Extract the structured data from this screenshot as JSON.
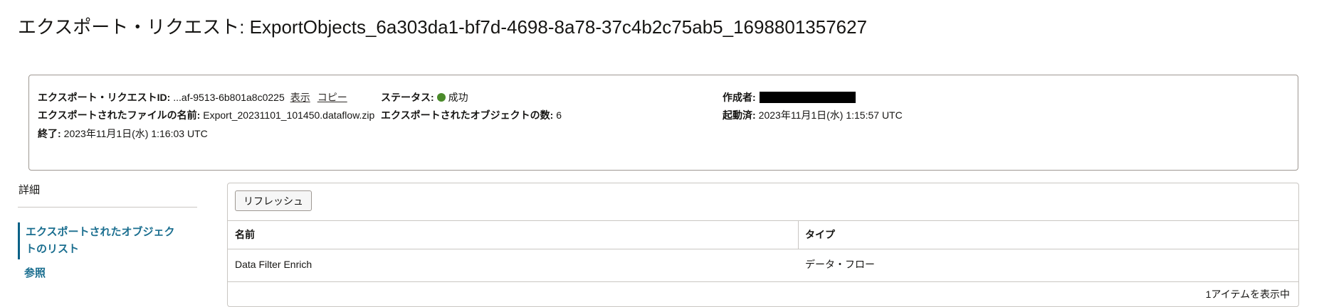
{
  "page": {
    "title": "エクスポート・リクエスト: ExportObjects_6a303da1-bf7d-4698-8a78-37c4b2c75ab5_1698801357627"
  },
  "details": {
    "request_id": {
      "label": "エクスポート・リクエストID",
      "value": "...af-9513-6b801a8c0225",
      "show_link": "表示",
      "copy_link": "コピー"
    },
    "status": {
      "label": "ステータス",
      "value": "成功",
      "color": "#4a8a2a"
    },
    "created_by": {
      "label": "作成者"
    },
    "exported_file": {
      "label": "エクスポートされたファイルの名前",
      "value": "Export_20231101_101450.dataflow.zip"
    },
    "object_count": {
      "label": "エクスポートされたオブジェクトの数",
      "value": "6"
    },
    "started": {
      "label": "起動済",
      "value": "2023年11月1日(水) 1:15:57 UTC"
    },
    "finished": {
      "label": "終了",
      "value": "2023年11月1日(水) 1:16:03 UTC"
    }
  },
  "sidebar": {
    "heading": "詳細",
    "items": [
      {
        "label": "エクスポートされたオブジェクトのリスト",
        "active": true
      },
      {
        "label": "参照",
        "active": false
      }
    ],
    "active_color": "#0a6187"
  },
  "table": {
    "refresh_label": "リフレッシュ",
    "columns": [
      "名前",
      "タイプ"
    ],
    "rows": [
      {
        "name": "Data Filter Enrich",
        "type": "データ・フロー"
      }
    ],
    "footer": "1アイテムを表示中"
  }
}
